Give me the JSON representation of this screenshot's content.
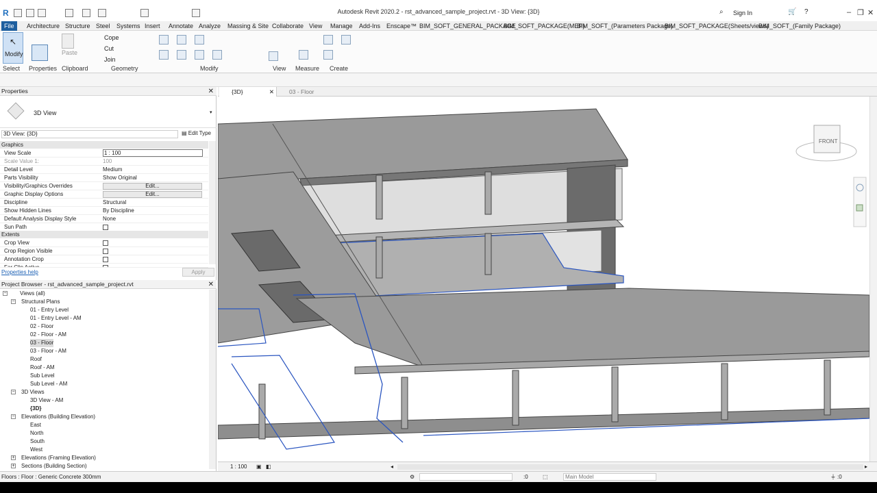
{
  "app": {
    "logo": "R",
    "title": "Autodesk Revit 2020.2 - rst_advanced_sample_project.rvt - 3D View: {3D}",
    "sign_in": "Sign In"
  },
  "ribbon_tabs": [
    "File",
    "Architecture",
    "Structure",
    "Steel",
    "Systems",
    "Insert",
    "Annotate",
    "Analyze",
    "Massing & Site",
    "Collaborate",
    "View",
    "Manage",
    "Add-Ins",
    "Enscape™",
    "BIM_SOFT_GENERAL_PACKAGE",
    "BIM_SOFT_PACKAGE(MEP)",
    "BIM_SOFT_(Parameters Package)",
    "BIM_SOFT_PACKAGE(Sheets/views)",
    "BIM_SOFT_(Family Package)"
  ],
  "ribbon": {
    "modify": "Modify",
    "select": "Select",
    "properties": "Properties",
    "paste": "Paste",
    "clipboard": "Clipboard",
    "cope": "Cope",
    "cut": "Cut",
    "join": "Join",
    "geometry": "Geometry",
    "modify_panel": "Modify",
    "view_panel": "View",
    "measure_panel": "Measure",
    "create_panel": "Create"
  },
  "properties_panel": {
    "title": "Properties",
    "type_name": "3D View",
    "instance_selector": "3D View: {3D}",
    "edit_type": "Edit Type",
    "section_graphics": "Graphics",
    "section_extents": "Extents",
    "rows": [
      {
        "k": "View Scale",
        "v": "1 : 100"
      },
      {
        "k": "Scale Value    1:",
        "v": "100"
      },
      {
        "k": "Detail Level",
        "v": "Medium"
      },
      {
        "k": "Parts Visibility",
        "v": "Show Original"
      },
      {
        "k": "Visibility/Graphics Overrides",
        "v": "Edit..."
      },
      {
        "k": "Graphic Display Options",
        "v": "Edit..."
      },
      {
        "k": "Discipline",
        "v": "Structural"
      },
      {
        "k": "Show Hidden Lines",
        "v": "By Discipline"
      },
      {
        "k": "Default Analysis Display Style",
        "v": "None"
      },
      {
        "k": "Sun Path",
        "v": ""
      }
    ],
    "extents_rows": [
      {
        "k": "Crop View"
      },
      {
        "k": "Crop Region Visible"
      },
      {
        "k": "Annotation Crop"
      },
      {
        "k": "Far Clip Active"
      }
    ],
    "help_link": "Properties help",
    "apply": "Apply"
  },
  "project_browser": {
    "title": "Project Browser - rst_advanced_sample_project.rvt",
    "items": [
      {
        "label": "Views (all)",
        "level": 0,
        "toggle": "−"
      },
      {
        "label": "Structural Plans",
        "level": 1,
        "toggle": "−"
      },
      {
        "label": "01 - Entry Level",
        "level": 2
      },
      {
        "label": "01 - Entry Level - AM",
        "level": 2
      },
      {
        "label": "02 - Floor",
        "level": 2
      },
      {
        "label": "02 - Floor - AM",
        "level": 2
      },
      {
        "label": "03 - Floor",
        "level": 2,
        "selected": true
      },
      {
        "label": "03 - Floor - AM",
        "level": 2
      },
      {
        "label": "Roof",
        "level": 2
      },
      {
        "label": "Roof - AM",
        "level": 2
      },
      {
        "label": "Sub Level",
        "level": 2
      },
      {
        "label": "Sub Level - AM",
        "level": 2
      },
      {
        "label": "3D Views",
        "level": 1,
        "toggle": "−"
      },
      {
        "label": "3D View - AM",
        "level": 2
      },
      {
        "label": "{3D}",
        "level": 2,
        "bold": true
      },
      {
        "label": "Elevations (Building Elevation)",
        "level": 1,
        "toggle": "−"
      },
      {
        "label": "East",
        "level": 2
      },
      {
        "label": "North",
        "level": 2
      },
      {
        "label": "South",
        "level": 2
      },
      {
        "label": "West",
        "level": 2
      },
      {
        "label": "Elevations (Framing Elevation)",
        "level": 1,
        "toggle": "+"
      },
      {
        "label": "Sections (Building Section)",
        "level": 1,
        "toggle": "+"
      }
    ]
  },
  "view_tabs": [
    {
      "label": "{3D}",
      "active": true
    },
    {
      "label": "03 - Floor",
      "active": false
    }
  ],
  "viewcube": {
    "face": "FRONT"
  },
  "view_control": {
    "scale": "1 : 100"
  },
  "status": {
    "text": "Floors : Floor : Generic Concrete 300mm",
    "selection_count": ":0",
    "filter_count": ":0",
    "model": "Main Model"
  }
}
